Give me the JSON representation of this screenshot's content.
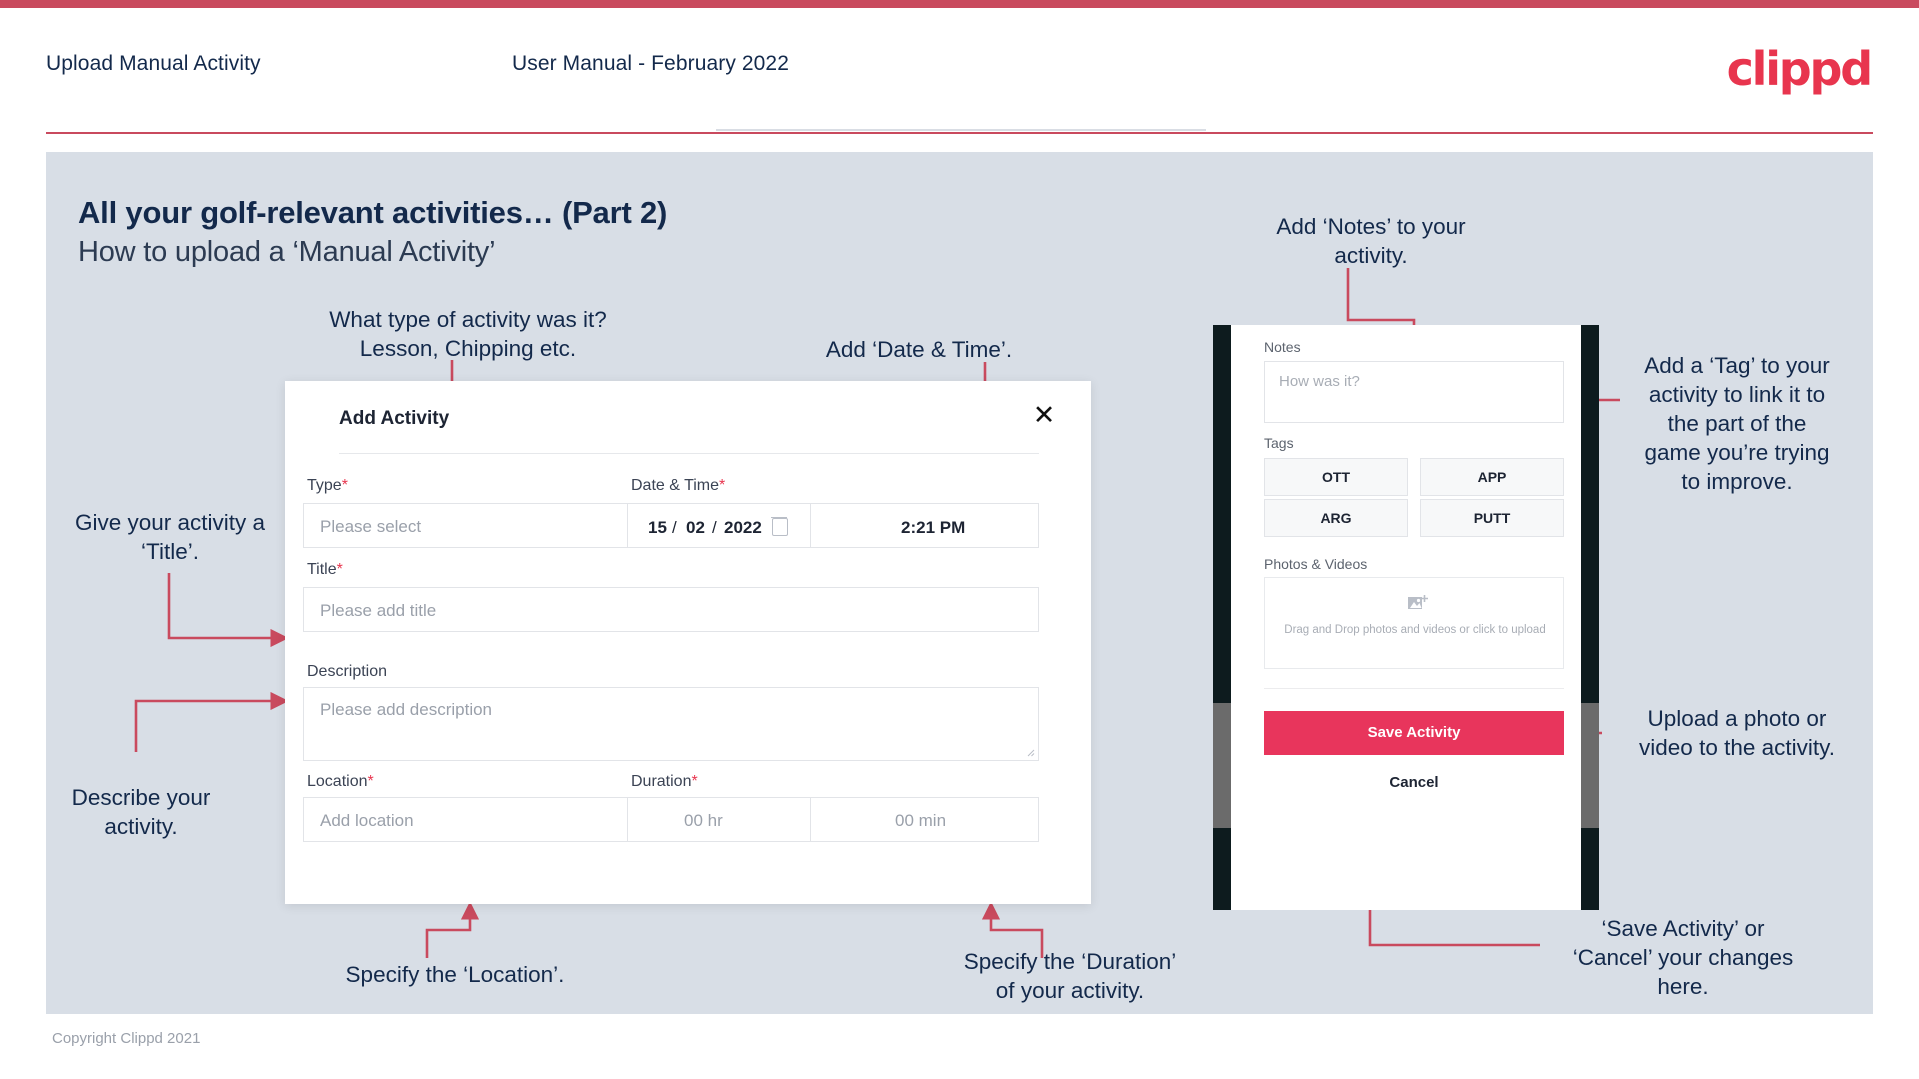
{
  "header": {
    "title": "Upload Manual Activity",
    "subtitle": "User Manual - February 2022",
    "brand": "clippd"
  },
  "slide": {
    "title": "All your golf-relevant activities… (Part 2)",
    "subtitle": "How to upload a ‘Manual Activity’"
  },
  "annotations": {
    "type": "What type of activity was it?\nLesson, Chipping etc.",
    "datetime": "Add ‘Date & Time’.",
    "title": "Give your activity a\n‘Title’.",
    "description": "Describe your\nactivity.",
    "location": "Specify the ‘Location’.",
    "duration": "Specify the ‘Duration’\nof your activity.",
    "notes": "Add ‘Notes’ to your\nactivity.",
    "tags": "Add a ‘Tag’ to your\nactivity to link it to\nthe part of the\ngame you’re trying\nto improve.",
    "photos": "Upload a photo or\nvideo to the activity.",
    "save": "‘Save Activity’ or\n‘Cancel’ your changes\nhere."
  },
  "dialog": {
    "title": "Add Activity",
    "close_icon": "close-icon",
    "fields": {
      "type_label": "Type",
      "type_placeholder": "Please select",
      "datetime_label": "Date & Time",
      "date_day": "15",
      "date_month": "02",
      "date_year": "2022",
      "date_sep": "/",
      "time_value": "2:21 PM",
      "title_label": "Title",
      "title_placeholder": "Please add title",
      "description_label": "Description",
      "description_placeholder": "Please add description",
      "location_label": "Location",
      "location_placeholder": "Add location",
      "duration_label": "Duration",
      "duration_hr_placeholder": "00 hr",
      "duration_min_placeholder": "00 min"
    },
    "required_mark": "*"
  },
  "phone": {
    "notes_label": "Notes",
    "notes_placeholder": "How was it?",
    "tags_label": "Tags",
    "tags": [
      "OTT",
      "APP",
      "ARG",
      "PUTT"
    ],
    "photos_label": "Photos & Videos",
    "drop_text": "Drag and Drop photos and videos or click to upload",
    "save_label": "Save Activity",
    "cancel_label": "Cancel"
  },
  "footer": {
    "copyright": "Copyright Clippd 2021"
  },
  "colors": {
    "accent": "#c94a5e",
    "brand": "#e8354e",
    "save": "#e8355c",
    "slide_bg": "#d8dee6",
    "text_dark": "#13294b"
  }
}
